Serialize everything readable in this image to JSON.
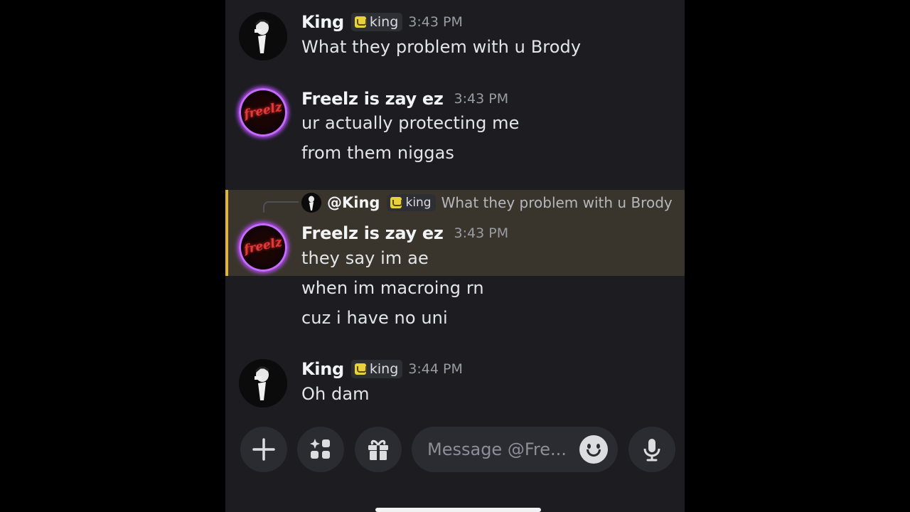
{
  "messages": [
    {
      "author": "King",
      "tag": "king",
      "time": "3:43 PM",
      "lines": [
        "What they problem with u Brody"
      ]
    },
    {
      "author": "Freelz is zay ez",
      "avatar_text": "freelz",
      "time": "3:43 PM",
      "lines": [
        "ur actually protecting me",
        "from them niggas"
      ]
    },
    {
      "reply": {
        "mention": "@King",
        "tag": "king",
        "text": "What they problem with u Brody"
      },
      "author": "Freelz is zay ez",
      "avatar_text": "freelz",
      "time": "3:43 PM",
      "lines": [
        "they say im ae",
        "when im macroing rn",
        "cuz i have no uni"
      ]
    },
    {
      "author": "King",
      "tag": "king",
      "time": "3:44 PM",
      "lines": [
        "Oh dam"
      ]
    }
  ],
  "composer": {
    "placeholder": "Message @Fre...",
    "buttons": [
      "plus-icon",
      "apps-icon",
      "gift-icon",
      "emoji-icon",
      "microphone-icon"
    ]
  },
  "colors": {
    "background": "#1c1c21",
    "highlight": "#3a352c",
    "highlight_border": "#e6b52e",
    "avatar_glow": "#b84dff"
  }
}
